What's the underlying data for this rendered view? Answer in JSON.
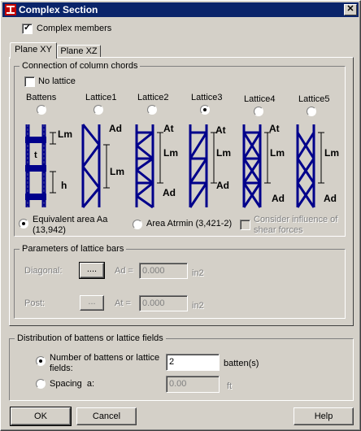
{
  "window": {
    "title": "Complex Section",
    "close_glyph": "✕"
  },
  "complex_members": {
    "label": "Complex members",
    "checked": true
  },
  "tabs": [
    {
      "label": "Plane XY",
      "active": true
    },
    {
      "label": "Plane XZ",
      "active": false
    }
  ],
  "connection": {
    "legend": "Connection of column chords",
    "no_lattice": {
      "label": "No lattice",
      "checked": false
    },
    "options": [
      {
        "label": "Battens",
        "selected": false
      },
      {
        "label": "Lattice1",
        "selected": false
      },
      {
        "label": "Lattice2",
        "selected": false
      },
      {
        "label": "Lattice3",
        "selected": true
      },
      {
        "label": "Lattice4",
        "selected": false
      },
      {
        "label": "Lattice5",
        "selected": false
      }
    ],
    "diagram_labels": {
      "lm": "Lm",
      "ad": "Ad",
      "at": "At",
      "t": "t",
      "h": "h"
    },
    "equivalent_area": {
      "label_line1": "Equivalent area Aa",
      "label_line2": "(13,942)",
      "selected": true
    },
    "area_atrmin": {
      "label": "Area Atrmin (3,421-2)",
      "selected": false
    },
    "shear": {
      "label_line1": "Consider influence of",
      "label_line2": "shear forces",
      "checked": false
    }
  },
  "lattice_bars": {
    "legend": "Parameters of lattice bars",
    "diagonal": {
      "label": "Diagonal:",
      "button": "....",
      "area_label": "Ad =",
      "value": "0.000",
      "unit": "in2"
    },
    "post": {
      "label": "Post:",
      "button": "...",
      "area_label": "At =",
      "value": "0.000",
      "unit": "in2"
    }
  },
  "distribution": {
    "legend": "Distribution of battens or lattice fields",
    "number": {
      "label_line1": "Number of battens or lattice",
      "label_line2": "fields:",
      "value": "2",
      "unit": "batten(s)",
      "selected": true
    },
    "spacing": {
      "label": "Spacing",
      "label_suffix": "a:",
      "value": "0.00",
      "unit": "ft",
      "selected": false
    }
  },
  "buttons": {
    "ok": "OK",
    "cancel": "Cancel",
    "help": "Help"
  },
  "colors": {
    "titlebar": "#0a246a",
    "diagram": "#00008b",
    "face": "#d4d0c8"
  }
}
